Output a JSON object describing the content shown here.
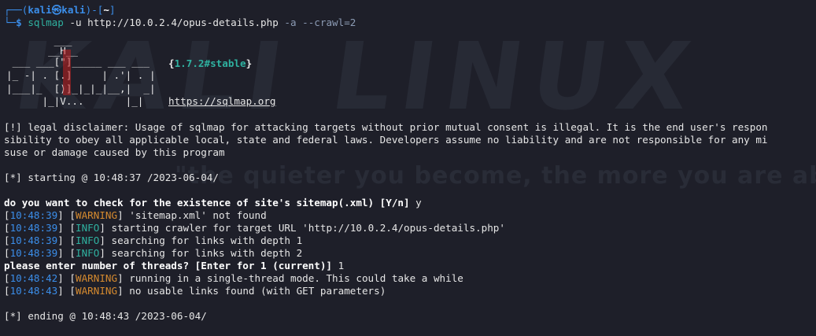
{
  "watermark": {
    "logo": "KALI LINUX",
    "quote": "\"the quieter you become, the more you are able to hear\""
  },
  "prompt": {
    "box_top": "┌──",
    "open": "(",
    "user": "kali",
    "at": "㉿",
    "host": "kali",
    "close": ")-[",
    "cwd": "~",
    "end": "]",
    "box_bottom": "└─",
    "dollar": "$ ",
    "cmd": "sqlmap",
    "args": " -u http://10.0.2.4/opus-details.php ",
    "flag_a": "-a",
    "flag_crawl": " --crawl=2"
  },
  "banner": {
    "logo_lines": [
      "        ___",
      "       __H__",
      " ___ ___[\"]_____ ___ ___",
      "|_ -| . [.]     | .'| . |",
      "|___|_  [)]_|_|_|__,|  _|",
      "      |_|V...       |_|"
    ],
    "version": "{1.7.2#stable}",
    "url": "https://sqlmap.org"
  },
  "disclaimer": [
    "[!] legal disclaimer: Usage of sqlmap for attacking targets without prior mutual consent is illegal. It is the end user's respon",
    "sibility to obey all applicable local, state and federal laws. Developers assume no liability and are not responsible for any mi",
    "suse or damage caused by this program"
  ],
  "starting": "[*] starting @ 10:48:37 /2023-06-04/",
  "sitemap_question": "do you want to check for the existence of site's sitemap(.xml) [Y/n] ",
  "sitemap_answer": "y",
  "log": [
    {
      "time": "10:48:39",
      "level": "WARNING",
      "msg": " 'sitemap.xml' not found"
    },
    {
      "time": "10:48:39",
      "level": "INFO",
      "msg": " starting crawler for target URL 'http://10.0.2.4/opus-details.php'"
    },
    {
      "time": "10:48:39",
      "level": "INFO",
      "msg": " searching for links with depth 1"
    },
    {
      "time": "10:48:39",
      "level": "INFO",
      "msg": " searching for links with depth 2"
    }
  ],
  "threads_question": "please enter number of threads? [Enter for 1 (current)] ",
  "threads_answer": "1",
  "log2": [
    {
      "time": "10:48:42",
      "level": "WARNING",
      "msg": " running in a single-thread mode. This could take a while"
    },
    {
      "time": "10:48:43",
      "level": "WARNING",
      "msg": " no usable links found (with GET parameters)"
    }
  ],
  "ending": "[*] ending @ 10:48:43 /2023-06-04/",
  "colors": {
    "background": "#1e1f29",
    "prompt_blue": "#3b8eea",
    "warning": "#d58a2f",
    "info": "#2fb1a0",
    "logo_red": "#ff2b2b"
  }
}
